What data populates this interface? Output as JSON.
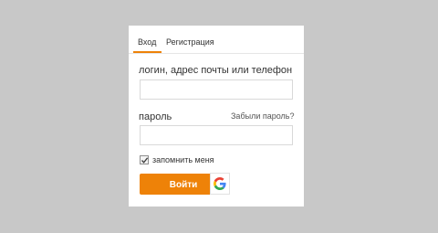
{
  "tabs": {
    "login": "Вход",
    "register": "Регистрация"
  },
  "form": {
    "login_label": "логин, адрес почты или телефон",
    "login_value": "",
    "password_label": "пароль",
    "password_value": "",
    "forgot_link": "Забыли пароль?",
    "remember_label": "запомнить меня",
    "remember_checked": true,
    "submit_label": "Войти",
    "google_icon": "google-icon"
  },
  "colors": {
    "accent": "#ee8208",
    "background": "#c8c8c8"
  }
}
